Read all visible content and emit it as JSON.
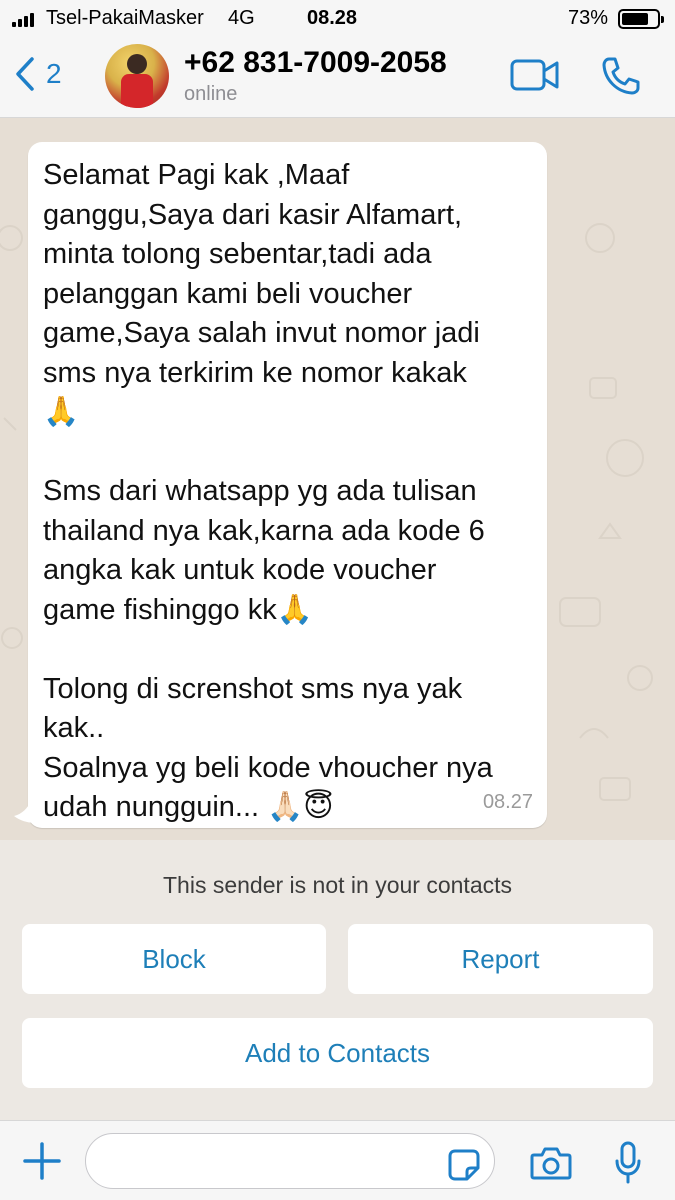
{
  "status_bar": {
    "carrier": "Tsel-PakaiMasker",
    "network": "4G",
    "time": "08.28",
    "battery": "73%"
  },
  "header": {
    "back_count": "2",
    "contact_name": "+62 831-7009-2058",
    "contact_status": "online",
    "icons": [
      "chevron-left-icon",
      "video-call-icon",
      "phone-icon"
    ]
  },
  "chat": {
    "message": {
      "text": "Selamat Pagi kak ,Maaf\nganggu,Saya dari kasir Alfamart,\nminta tolong sebentar,tadi ada\npelanggan kami beli voucher\ngame,Saya salah invut nomor jadi\nsms nya terkirim ke nomor kakak\n🙏\n\nSms dari whatsapp yg ada tulisan\nthailand nya kak,karna ada kode 6\nangka kak untuk kode voucher\ngame fishinggo kk🙏\n\nTolong di screnshot sms nya yak\nkak..\nSoalnya yg beli kode vhoucher nya\nudah nungguin... 🙏🏻😇",
      "time": "08.27"
    }
  },
  "notice": {
    "text": "This sender is not in your contacts",
    "block_label": "Block",
    "report_label": "Report",
    "add_label": "Add to Contacts"
  },
  "input_bar": {
    "placeholder": "",
    "icons": [
      "plus-icon",
      "sticker-icon",
      "camera-icon",
      "microphone-icon"
    ]
  },
  "colors": {
    "accent": "#1e7fc8",
    "chat_background": "#e6ded4",
    "bubble": "#ffffff"
  }
}
